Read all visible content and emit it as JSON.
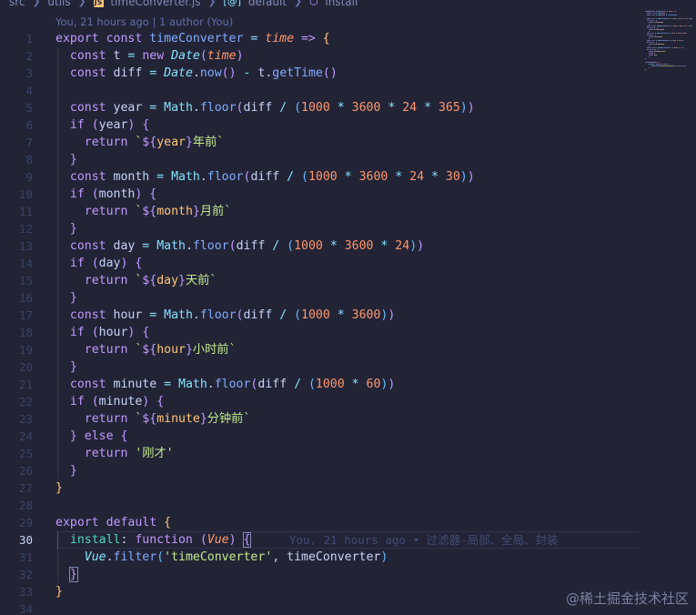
{
  "breadcrumb": {
    "src": "src",
    "utils": "utils",
    "file_badge": "JS",
    "file": "timeConverter.js",
    "default": "default",
    "install": "install"
  },
  "blame_header": "You, 21 hours ago | 1 author (You)",
  "active_line": 30,
  "inline_blame": "You, 21 hours ago • 过滤器-局部、全局、封装",
  "code_lines": [
    [
      [
        "export const ",
        "kw"
      ],
      [
        "timeConverter",
        "fn"
      ],
      [
        " = ",
        "op"
      ],
      [
        "time",
        "par"
      ],
      [
        " => ",
        "kw"
      ],
      [
        "{",
        "b1"
      ]
    ],
    [
      [
        "  const ",
        "kw"
      ],
      [
        "t",
        "plain"
      ],
      [
        " = ",
        "op"
      ],
      [
        "new ",
        "kw"
      ],
      [
        "Date",
        "cls"
      ],
      [
        "(",
        "b2"
      ],
      [
        "time",
        "par"
      ],
      [
        ")",
        "b2"
      ]
    ],
    [
      [
        "  const ",
        "kw"
      ],
      [
        "diff",
        "plain"
      ],
      [
        " = ",
        "op"
      ],
      [
        "Date",
        "cls"
      ],
      [
        ".",
        "plain"
      ],
      [
        "now",
        "fn"
      ],
      [
        "()",
        "b2"
      ],
      [
        " - ",
        "op"
      ],
      [
        "t",
        "plain"
      ],
      [
        ".",
        "plain"
      ],
      [
        "getTime",
        "fn"
      ],
      [
        "()",
        "b2"
      ]
    ],
    [],
    [
      [
        "  const ",
        "kw"
      ],
      [
        "year",
        "plain"
      ],
      [
        " = ",
        "op"
      ],
      [
        "Math",
        "cls2"
      ],
      [
        ".",
        "plain"
      ],
      [
        "floor",
        "fn"
      ],
      [
        "(",
        "b2"
      ],
      [
        "diff",
        "plain"
      ],
      [
        " / ",
        "op"
      ],
      [
        "(",
        "b3"
      ],
      [
        "1000",
        "num"
      ],
      [
        " * ",
        "op"
      ],
      [
        "3600",
        "num"
      ],
      [
        " * ",
        "op"
      ],
      [
        "24",
        "num"
      ],
      [
        " * ",
        "op"
      ],
      [
        "365",
        "num"
      ],
      [
        ")",
        "b3"
      ],
      [
        ")",
        "b2"
      ]
    ],
    [
      [
        "  if ",
        "kw"
      ],
      [
        "(",
        "b2"
      ],
      [
        "year",
        "plain"
      ],
      [
        ")",
        "b2"
      ],
      [
        " ",
        "plain"
      ],
      [
        "{",
        "b2"
      ]
    ],
    [
      [
        "    return ",
        "kw"
      ],
      [
        "`",
        "str"
      ],
      [
        "${",
        "interp"
      ],
      [
        "year",
        "ip"
      ],
      [
        "}",
        "interp"
      ],
      [
        "年前`",
        "str"
      ]
    ],
    [
      [
        "  ",
        "plain"
      ],
      [
        "}",
        "b2"
      ]
    ],
    [
      [
        "  const ",
        "kw"
      ],
      [
        "month",
        "plain"
      ],
      [
        " = ",
        "op"
      ],
      [
        "Math",
        "cls2"
      ],
      [
        ".",
        "plain"
      ],
      [
        "floor",
        "fn"
      ],
      [
        "(",
        "b2"
      ],
      [
        "diff",
        "plain"
      ],
      [
        " / ",
        "op"
      ],
      [
        "(",
        "b3"
      ],
      [
        "1000",
        "num"
      ],
      [
        " * ",
        "op"
      ],
      [
        "3600",
        "num"
      ],
      [
        " * ",
        "op"
      ],
      [
        "24",
        "num"
      ],
      [
        " * ",
        "op"
      ],
      [
        "30",
        "num"
      ],
      [
        ")",
        "b3"
      ],
      [
        ")",
        "b2"
      ]
    ],
    [
      [
        "  if ",
        "kw"
      ],
      [
        "(",
        "b2"
      ],
      [
        "month",
        "plain"
      ],
      [
        ")",
        "b2"
      ],
      [
        " ",
        "plain"
      ],
      [
        "{",
        "b2"
      ]
    ],
    [
      [
        "    return ",
        "kw"
      ],
      [
        "`",
        "str"
      ],
      [
        "${",
        "interp"
      ],
      [
        "month",
        "ip"
      ],
      [
        "}",
        "interp"
      ],
      [
        "月前`",
        "str"
      ]
    ],
    [
      [
        "  ",
        "plain"
      ],
      [
        "}",
        "b2"
      ]
    ],
    [
      [
        "  const ",
        "kw"
      ],
      [
        "day",
        "plain"
      ],
      [
        " = ",
        "op"
      ],
      [
        "Math",
        "cls2"
      ],
      [
        ".",
        "plain"
      ],
      [
        "floor",
        "fn"
      ],
      [
        "(",
        "b2"
      ],
      [
        "diff",
        "plain"
      ],
      [
        " / ",
        "op"
      ],
      [
        "(",
        "b3"
      ],
      [
        "1000",
        "num"
      ],
      [
        " * ",
        "op"
      ],
      [
        "3600",
        "num"
      ],
      [
        " * ",
        "op"
      ],
      [
        "24",
        "num"
      ],
      [
        ")",
        "b3"
      ],
      [
        ")",
        "b2"
      ]
    ],
    [
      [
        "  if ",
        "kw"
      ],
      [
        "(",
        "b2"
      ],
      [
        "day",
        "plain"
      ],
      [
        ")",
        "b2"
      ],
      [
        " ",
        "plain"
      ],
      [
        "{",
        "b2"
      ]
    ],
    [
      [
        "    return ",
        "kw"
      ],
      [
        "`",
        "str"
      ],
      [
        "${",
        "interp"
      ],
      [
        "day",
        "ip"
      ],
      [
        "}",
        "interp"
      ],
      [
        "天前`",
        "str"
      ]
    ],
    [
      [
        "  ",
        "plain"
      ],
      [
        "}",
        "b2"
      ]
    ],
    [
      [
        "  const ",
        "kw"
      ],
      [
        "hour",
        "plain"
      ],
      [
        " = ",
        "op"
      ],
      [
        "Math",
        "cls2"
      ],
      [
        ".",
        "plain"
      ],
      [
        "floor",
        "fn"
      ],
      [
        "(",
        "b2"
      ],
      [
        "diff",
        "plain"
      ],
      [
        " / ",
        "op"
      ],
      [
        "(",
        "b3"
      ],
      [
        "1000",
        "num"
      ],
      [
        " * ",
        "op"
      ],
      [
        "3600",
        "num"
      ],
      [
        ")",
        "b3"
      ],
      [
        ")",
        "b2"
      ]
    ],
    [
      [
        "  if ",
        "kw"
      ],
      [
        "(",
        "b2"
      ],
      [
        "hour",
        "plain"
      ],
      [
        ")",
        "b2"
      ],
      [
        " ",
        "plain"
      ],
      [
        "{",
        "b2"
      ]
    ],
    [
      [
        "    return ",
        "kw"
      ],
      [
        "`",
        "str"
      ],
      [
        "${",
        "interp"
      ],
      [
        "hour",
        "ip"
      ],
      [
        "}",
        "interp"
      ],
      [
        "小时前`",
        "str"
      ]
    ],
    [
      [
        "  ",
        "plain"
      ],
      [
        "}",
        "b2"
      ]
    ],
    [
      [
        "  const ",
        "kw"
      ],
      [
        "minute",
        "plain"
      ],
      [
        " = ",
        "op"
      ],
      [
        "Math",
        "cls2"
      ],
      [
        ".",
        "plain"
      ],
      [
        "floor",
        "fn"
      ],
      [
        "(",
        "b2"
      ],
      [
        "diff",
        "plain"
      ],
      [
        " / ",
        "op"
      ],
      [
        "(",
        "b3"
      ],
      [
        "1000",
        "num"
      ],
      [
        " * ",
        "op"
      ],
      [
        "60",
        "num"
      ],
      [
        ")",
        "b3"
      ],
      [
        ")",
        "b2"
      ]
    ],
    [
      [
        "  if ",
        "kw"
      ],
      [
        "(",
        "b2"
      ],
      [
        "minute",
        "plain"
      ],
      [
        ")",
        "b2"
      ],
      [
        " ",
        "plain"
      ],
      [
        "{",
        "b2"
      ]
    ],
    [
      [
        "    return ",
        "kw"
      ],
      [
        "`",
        "str"
      ],
      [
        "${",
        "interp"
      ],
      [
        "minute",
        "ip"
      ],
      [
        "}",
        "interp"
      ],
      [
        "分钟前`",
        "str"
      ]
    ],
    [
      [
        "  ",
        "plain"
      ],
      [
        "}",
        "b2"
      ],
      [
        " else ",
        "kw"
      ],
      [
        "{",
        "b2"
      ]
    ],
    [
      [
        "    return ",
        "kw"
      ],
      [
        "'刚才'",
        "str"
      ]
    ],
    [
      [
        "  ",
        "plain"
      ],
      [
        "}",
        "b2"
      ]
    ],
    [
      [
        "}",
        "b1"
      ]
    ],
    [],
    [
      [
        "export default ",
        "kw"
      ],
      [
        "{",
        "b1"
      ]
    ],
    [
      [
        "  ",
        "plain"
      ],
      [
        "install",
        "prop"
      ],
      [
        ": ",
        "plain"
      ],
      [
        "function ",
        "kw"
      ],
      [
        "(",
        "b2"
      ],
      [
        "Vue",
        "par"
      ],
      [
        ")",
        "b2"
      ],
      [
        " ",
        "plain"
      ],
      [
        "{",
        "b2box"
      ]
    ],
    [
      [
        "    ",
        "plain"
      ],
      [
        "Vue",
        "cls"
      ],
      [
        ".",
        "plain"
      ],
      [
        "filter",
        "fn"
      ],
      [
        "(",
        "b3"
      ],
      [
        "'timeConverter'",
        "str"
      ],
      [
        ", ",
        "plain"
      ],
      [
        "timeConverter",
        "plain"
      ],
      [
        ")",
        "b3"
      ]
    ],
    [
      [
        "  ",
        "plain"
      ],
      [
        "}",
        "b2box"
      ]
    ],
    [
      [
        "}",
        "b1"
      ]
    ],
    []
  ],
  "watermark": "@稀土掘金技术社区"
}
